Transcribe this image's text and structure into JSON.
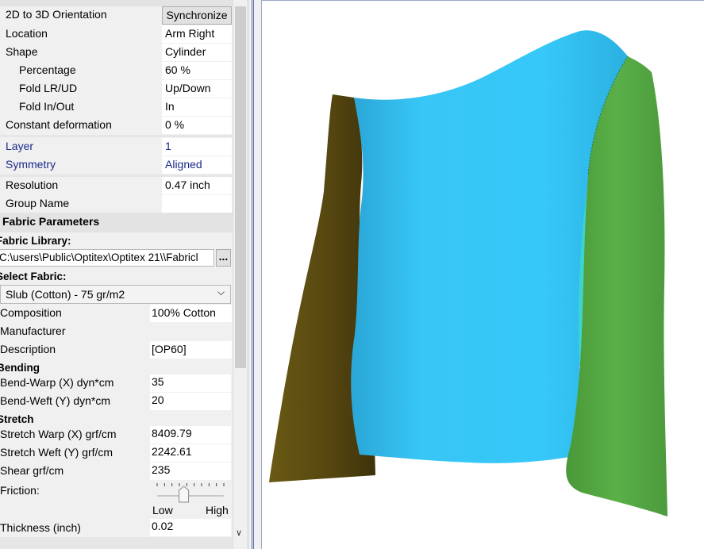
{
  "orientation": {
    "label": "2D to 3D Orientation",
    "button": "Synchronize"
  },
  "props": {
    "location": {
      "label": "Location",
      "value": "Arm Right"
    },
    "shape": {
      "label": "Shape",
      "value": "Cylinder"
    },
    "percentage": {
      "label": "Percentage",
      "value": "60 %"
    },
    "fold_lrud": {
      "label": "Fold LR/UD",
      "value": "Up/Down"
    },
    "fold_inout": {
      "label": "Fold In/Out",
      "value": "In"
    },
    "constant_deformation": {
      "label": "Constant deformation",
      "value": "0 %"
    },
    "layer": {
      "label": "Layer",
      "value": "1"
    },
    "symmetry": {
      "label": "Symmetry",
      "value": "Aligned"
    },
    "resolution": {
      "label": "Resolution",
      "value": "0.47 inch"
    },
    "group_name": {
      "label": "Group Name",
      "value": ""
    }
  },
  "fabric": {
    "section_title": "Fabric Parameters",
    "library_label": "Fabric Library:",
    "library_path": "C:\\users\\Public\\Optitex\\Optitex 21\\\\Fabricl",
    "browse_label": "...",
    "select_label": "Select Fabric:",
    "selected": "Slub (Cotton)  - 75 gr/m2",
    "composition": {
      "label": "Composition",
      "value": "100% Cotton"
    },
    "manufacturer": {
      "label": "Manufacturer",
      "value": ""
    },
    "description": {
      "label": "Description",
      "value": "[OP60]"
    },
    "bending_title": "Bending",
    "bend_warp": {
      "label": "Bend-Warp (X) dyn*cm",
      "value": "35"
    },
    "bend_weft": {
      "label": "Bend-Weft (Y) dyn*cm",
      "value": "20"
    },
    "stretch_title": "Stretch",
    "stretch_warp": {
      "label": "Stretch Warp (X) grf/cm",
      "value": "8409.79"
    },
    "stretch_weft": {
      "label": "Stretch Weft (Y) grf/cm",
      "value": "2242.61"
    },
    "shear": {
      "label": "Shear grf/cm",
      "value": "235"
    },
    "friction": {
      "label": "Friction:",
      "low": "Low",
      "high": "High",
      "level": 0.4
    },
    "thickness": {
      "label": "Thickness (inch)",
      "value": "0.02"
    }
  },
  "colors": {
    "body": "#35c4f4",
    "left_sleeve": "#5a4a10",
    "right_sleeve": "#56a843",
    "inner_panel": "#3fd4d0",
    "accent_text": "#1a2a8a"
  },
  "icons": {
    "dropdown": "chevron-down-icon",
    "scroll_down": "chevron-down-icon",
    "splitter": "splitter-handle"
  }
}
